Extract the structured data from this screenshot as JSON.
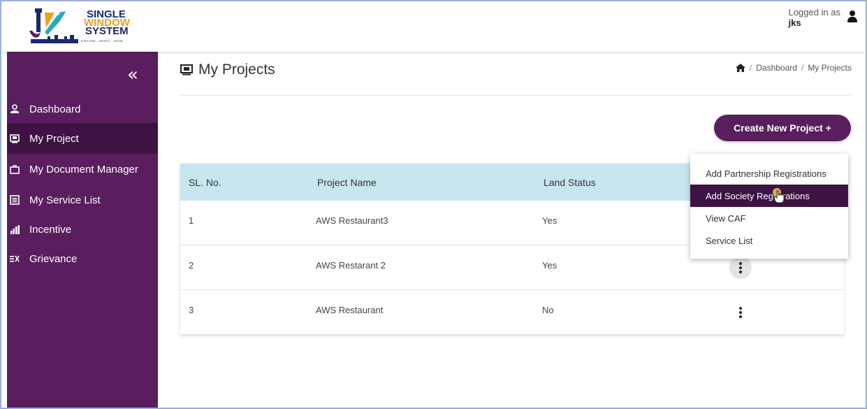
{
  "header": {
    "logo": {
      "line1": "SINGLE",
      "line2": "WINDOW",
      "line3": "SYSTEM",
      "tagline": "EXPLORE · INVEST · GROW"
    },
    "login_label": "Logged in as",
    "username": "jks",
    "user_icon": "user-icon"
  },
  "sidebar": {
    "collapse_glyph": "«",
    "items": [
      {
        "label": "Dashboard",
        "icon": "person-icon"
      },
      {
        "label": "My Project",
        "icon": "projects-icon",
        "active": true
      },
      {
        "label": "My Document Manager",
        "icon": "briefcase-icon"
      },
      {
        "label": "My Service List",
        "icon": "list-icon"
      },
      {
        "label": "Incentive",
        "icon": "bar-chart-icon"
      },
      {
        "label": "Grievance",
        "icon": "grievance-icon"
      }
    ]
  },
  "main": {
    "title": "My Projects",
    "breadcrumb": [
      "Dashboard",
      "My Projects"
    ],
    "create_button": "Create New Project +",
    "table": {
      "headers": [
        "SL. No.",
        "Project Name",
        "Land Status"
      ],
      "rows": [
        {
          "sl": "1",
          "name": "AWS Restaurant3",
          "land": "Yes"
        },
        {
          "sl": "2",
          "name": "AWS Restarant 2",
          "land": "Yes"
        },
        {
          "sl": "3",
          "name": "AWS Restaurant",
          "land": "No"
        }
      ]
    },
    "dropdown": {
      "items": [
        "Add Partnership Registrations",
        "Add Society Registrations",
        "View CAF",
        "Service List"
      ],
      "active_index": 1
    }
  },
  "colors": {
    "sidebar": "#5a1e5f",
    "sidebar_active": "#3e1242",
    "table_header": "#c8e6f0",
    "button": "#5a1e5f"
  }
}
